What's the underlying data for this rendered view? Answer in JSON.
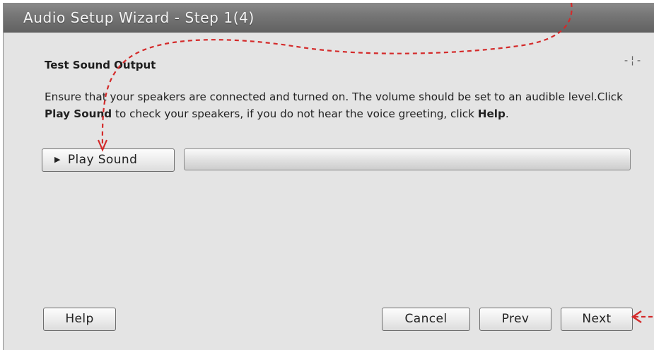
{
  "window": {
    "title": "Audio Setup Wizard - Step 1(4)"
  },
  "section": {
    "title": "Test Sound Output",
    "corner_icon": "crosshair-icon"
  },
  "instructions": {
    "part1": "Ensure that your speakers are connected and turned on. The volume should be set to an audible level.Click ",
    "bold1": "Play Sound",
    "part2": " to check your speakers, if you do not hear the voice greeting, click ",
    "bold2": "Help",
    "part3": "."
  },
  "play": {
    "label": "Play Sound",
    "icon": "play-triangle-icon"
  },
  "progress": {
    "value": 0
  },
  "footer": {
    "help": "Help",
    "cancel": "Cancel",
    "prev": "Prev",
    "next": "Next"
  },
  "annotation": {
    "color": "#d42a2a"
  }
}
